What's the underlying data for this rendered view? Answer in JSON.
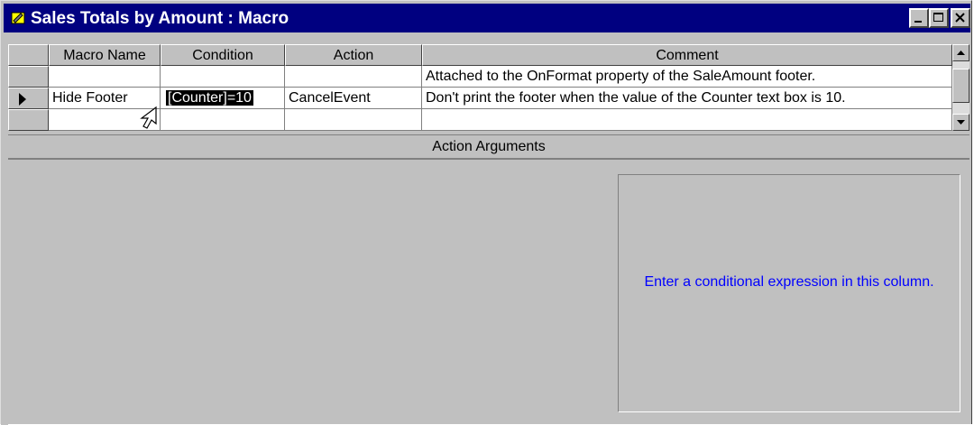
{
  "window": {
    "title": "Sales Totals by Amount : Macro",
    "icon": "macro-icon",
    "title_bar_color": "#000080"
  },
  "grid": {
    "columns": [
      "Macro Name",
      "Condition",
      "Action",
      "Comment"
    ],
    "rows": [
      {
        "macro_name": "",
        "condition": "",
        "action": "",
        "comment": "Attached to the OnFormat property of the SaleAmount footer.",
        "current": false
      },
      {
        "macro_name": "Hide Footer",
        "condition": "[Counter]=10",
        "action": "CancelEvent",
        "comment": "Don't print the footer when the value of the Counter text box is 10.",
        "current": true
      },
      {
        "macro_name": "",
        "condition": "",
        "action": "",
        "comment": "",
        "current": false
      }
    ]
  },
  "action_arguments": {
    "label": "Action Arguments",
    "help_text": "Enter a conditional expression in this column.",
    "help_color": "#0000ff"
  }
}
